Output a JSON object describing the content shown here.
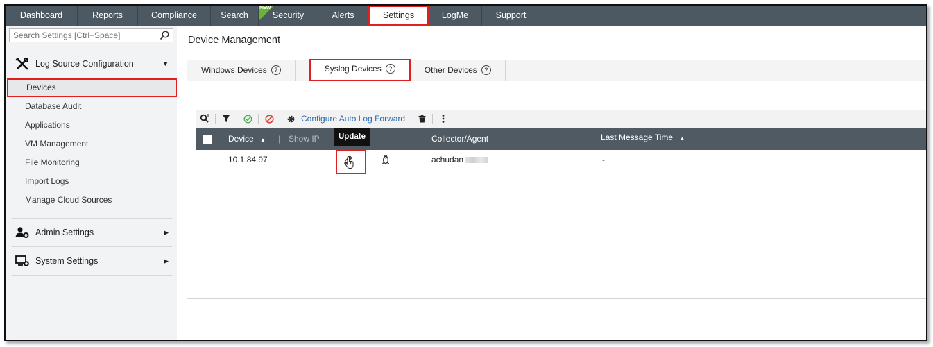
{
  "topnav": {
    "tabs": [
      {
        "label": "Dashboard"
      },
      {
        "label": "Reports"
      },
      {
        "label": "Compliance"
      },
      {
        "label": "Search"
      },
      {
        "label": "Security",
        "badge": "NEW"
      },
      {
        "label": "Alerts"
      },
      {
        "label": "Settings",
        "active": true
      },
      {
        "label": "LogMe"
      },
      {
        "label": "Support"
      }
    ]
  },
  "sidebar": {
    "search_placeholder": "Search Settings [Ctrl+Space]",
    "log_source": {
      "label": "Log Source Configuration",
      "items": [
        {
          "label": "Devices",
          "active": true
        },
        {
          "label": "Database Audit"
        },
        {
          "label": "Applications"
        },
        {
          "label": "VM Management"
        },
        {
          "label": "File Monitoring"
        },
        {
          "label": "Import Logs"
        },
        {
          "label": "Manage Cloud Sources"
        }
      ]
    },
    "admin_settings": {
      "label": "Admin Settings"
    },
    "system_settings": {
      "label": "System Settings"
    }
  },
  "main": {
    "title": "Device Management",
    "tabs": [
      {
        "label": "Windows Devices",
        "help": "?"
      },
      {
        "label": "Syslog Devices",
        "help": "?",
        "active": true
      },
      {
        "label": "Other Devices",
        "help": "?"
      }
    ],
    "toolbar": {
      "configure_label": "Configure Auto Log Forward"
    },
    "grid": {
      "columns": {
        "device": "Device",
        "show_ip": "Show IP",
        "collector": "Collector/Agent",
        "last_message": "Last Message Time"
      },
      "rows": [
        {
          "device": "10.1.84.97",
          "collector": "achudan",
          "last_message": "-"
        }
      ]
    },
    "tooltip": "Update"
  },
  "colors": {
    "nav_bg": "#4c5963",
    "grid_header_bg": "#4f5a63",
    "highlight_red": "#e02020",
    "link_blue": "#2b6cb0",
    "new_badge_green": "#6bb23a"
  }
}
